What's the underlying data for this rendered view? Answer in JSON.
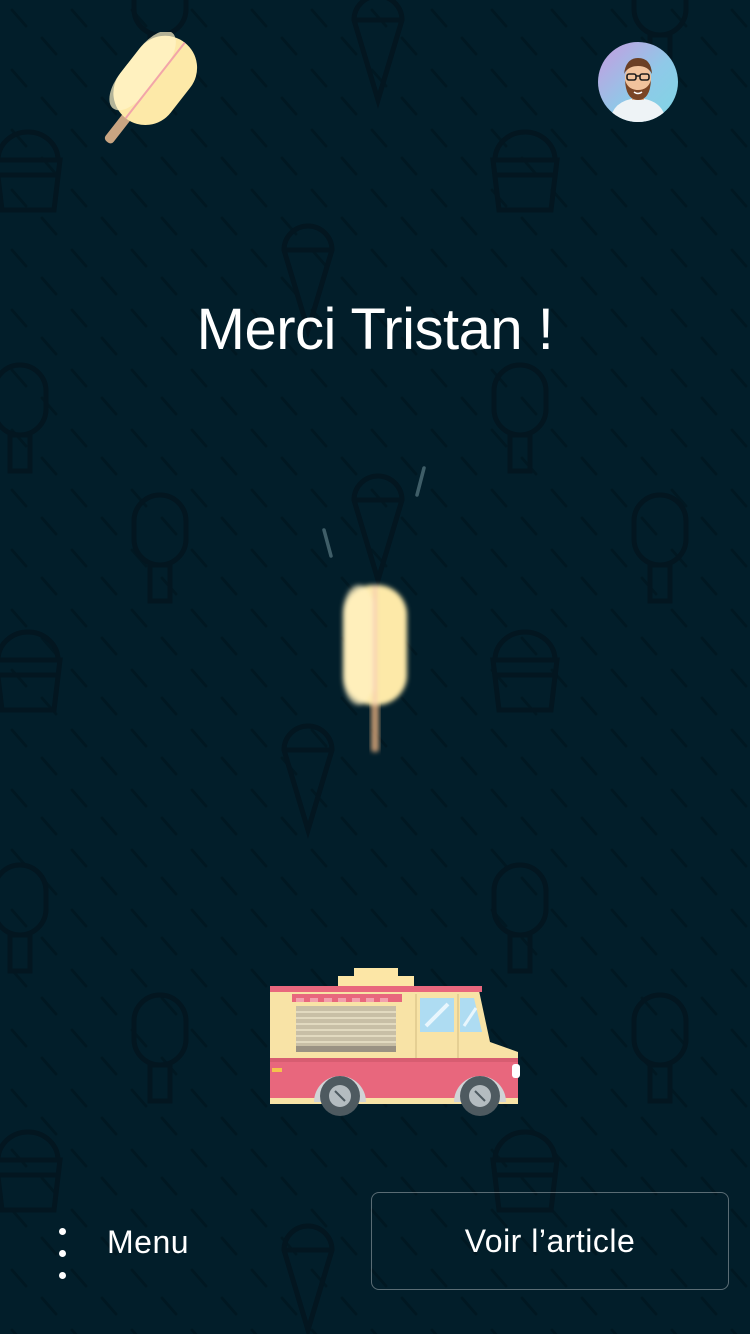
{
  "header": {
    "logo_icon": "popsicle-icon",
    "avatar_icon": "user-avatar-icon"
  },
  "main": {
    "title": "Merci Tristan !",
    "falling_icon": "popsicle-icon",
    "vehicle_icon": "ice-cream-truck-icon"
  },
  "footer": {
    "menu_icon": "vertical-dots-icon",
    "menu_label": "Menu",
    "cta_label": "Voir l’article"
  },
  "colors": {
    "background": "#021e2a",
    "text": "#ffffff",
    "cream": "#fde9a8",
    "pink": "#e8677d"
  }
}
